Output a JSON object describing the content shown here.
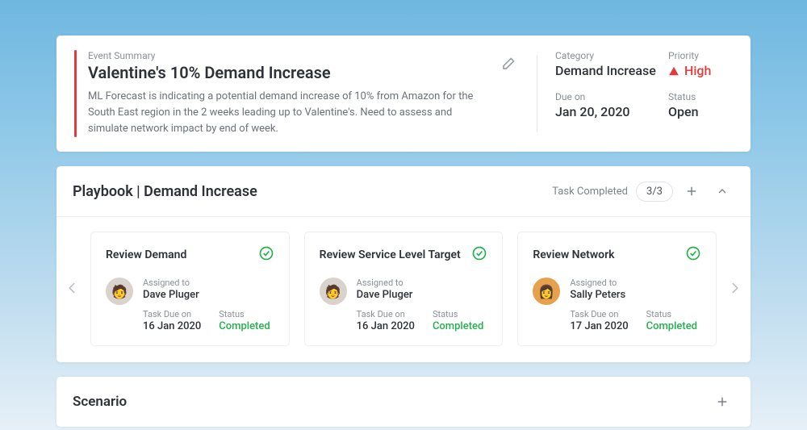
{
  "summary": {
    "label": "Event Summary",
    "title": "Valentine's 10% Demand Increase",
    "description": "ML Forecast is indicating a potential demand increase of 10% from Amazon for the South East region in the 2 weeks leading up to Valentine's. Need to assess and simulate network impact by end of week.",
    "category_label": "Category",
    "category_value": "Demand Increase",
    "priority_label": "Priority",
    "priority_value": "High",
    "due_label": "Due on",
    "due_value": "Jan 20, 2020",
    "status_label": "Status",
    "status_value": "Open"
  },
  "playbook": {
    "title": "Playbook | Demand Increase",
    "task_completed_label": "Task Completed",
    "task_completed_count": "3/3",
    "assigned_label": "Assigned to",
    "due_label": "Task Due on",
    "status_label": "Status",
    "tasks": [
      {
        "title": "Review Demand",
        "assignee": "Dave Pluger",
        "due": "16 Jan 2020",
        "status": "Completed",
        "avatar_bg": "#d9d2cd",
        "avatar_letter": "🧑"
      },
      {
        "title": "Review Service Level Target",
        "assignee": "Dave Pluger",
        "due": "16 Jan 2020",
        "status": "Completed",
        "avatar_bg": "#d9d2cd",
        "avatar_letter": "🧑"
      },
      {
        "title": "Review Network",
        "assignee": "Sally Peters",
        "due": "17 Jan 2020",
        "status": "Completed",
        "avatar_bg": "#e6a14d",
        "avatar_letter": "👩"
      }
    ]
  },
  "scenario": {
    "title": "Scenario"
  }
}
